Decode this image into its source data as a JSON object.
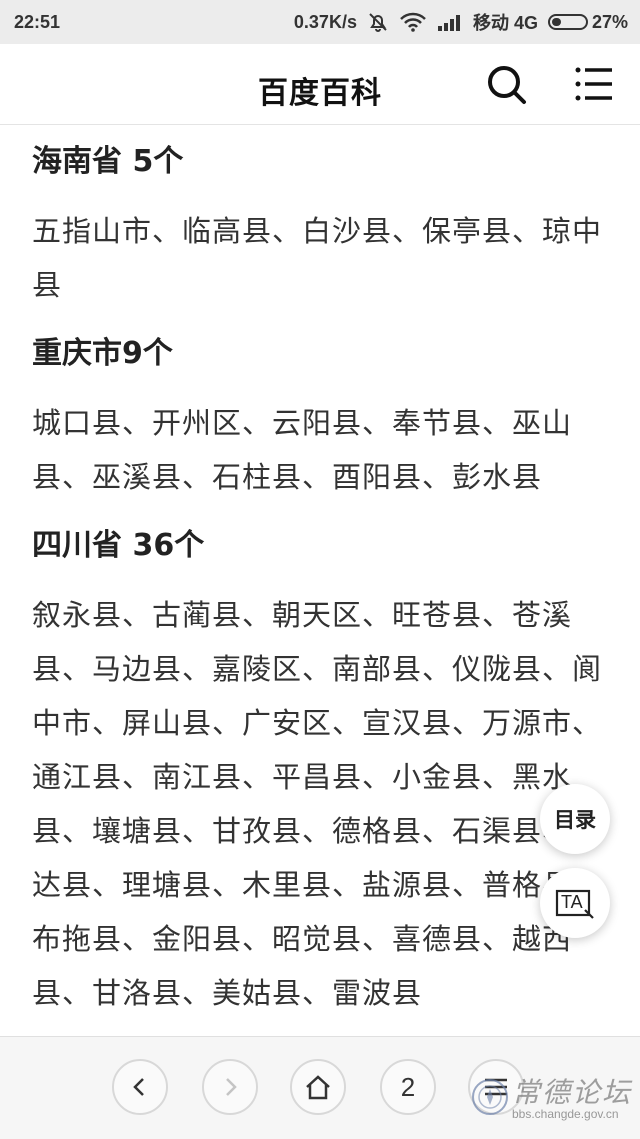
{
  "status_bar": {
    "time": "22:51",
    "speed": "0.37K/s",
    "carrier": "移动 4G",
    "battery": "27%",
    "battery_level": 0.27
  },
  "header": {
    "title": "百度百科"
  },
  "sections": [
    {
      "title": "海南省 5个",
      "body": "五指山市、临高县、白沙县、保亭县、琼中县"
    },
    {
      "title": "重庆市9个",
      "body": "城口县、开州区、云阳县、奉节县、巫山县、巫溪县、石柱县、酉阳县、彭水县"
    },
    {
      "title": "四川省 36个",
      "body": "叙永县、古蔺县、朝天区、旺苍县、苍溪县、马边县、嘉陵区、南部县、仪陇县、阆中市、屏山县、广安区、宣汉县、万源市、通江县、南江县、平昌县、小金县、黑水县、壤塘县、甘孜县、德格县、石渠县、色达县、理塘县、木里县、盐源县、普格县、布拖县、金阳县、昭觉县、喜德县、越西县、甘洛县、美姑县、雷波县"
    }
  ],
  "floating": {
    "toc_label": "目录",
    "ta_label": "TA"
  },
  "bottom_nav": {
    "tab_count": "2"
  },
  "watermark": {
    "text": "常德论坛",
    "url": "bbs.changde.gov.cn"
  }
}
